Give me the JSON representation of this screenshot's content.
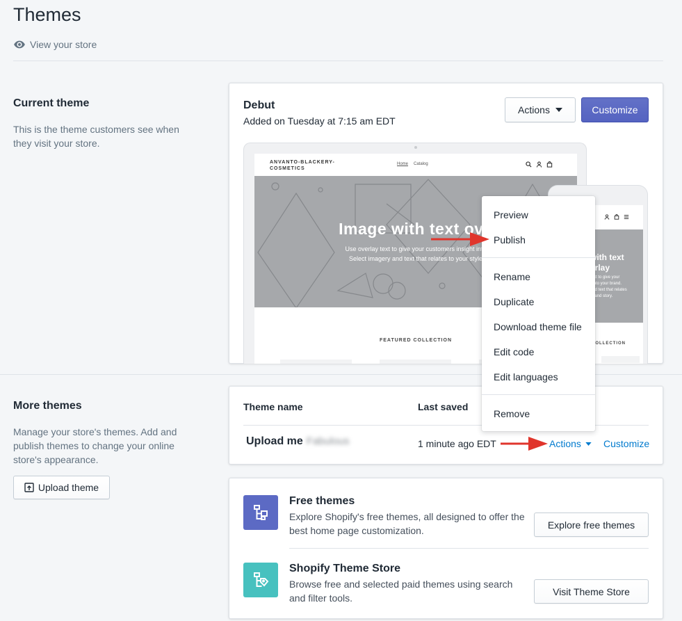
{
  "page": {
    "title": "Themes",
    "view_store": "View your store"
  },
  "current": {
    "section_title": "Current theme",
    "section_desc": "This is the theme customers see when they visit your store.",
    "theme_name": "Debut",
    "added": "Added on Tuesday at 7:15 am EDT",
    "actions_label": "Actions",
    "customize_label": "Customize"
  },
  "preview": {
    "brand_line1": "ANVANTO-BLACKERY-",
    "brand_line2": "COSMETICS",
    "nav": [
      "Home",
      "Catalog"
    ],
    "hero_title": "Image with text ove",
    "hero_sub1": "Use overlay text to give your customers insight into",
    "hero_sub2": "Select imagery and text that relates to your style",
    "featured": "FEATURED COLLECTION",
    "phone_hero_1": "with text",
    "phone_hero_2": "erlay",
    "phone_hero_sub": "text to give your\nt into your brand.\nand text that relates\nle and story.",
    "phone_featured": "COLLECTION"
  },
  "menu": {
    "items": [
      "Preview",
      "Publish",
      "Rename",
      "Duplicate",
      "Download theme file",
      "Edit code",
      "Edit languages",
      "Remove"
    ]
  },
  "more": {
    "section_title": "More themes",
    "section_desc": "Manage your store's themes. Add and publish themes to change your online store's appearance.",
    "upload_label": "Upload theme",
    "col_name": "Theme name",
    "col_saved": "Last saved",
    "row": {
      "name": "Upload me",
      "name_blurred": "Fabulous",
      "saved": "1 minute ago EDT",
      "actions": "Actions",
      "customize": "Customize"
    }
  },
  "promos": [
    {
      "title": "Free themes",
      "desc": "Explore Shopify's free themes, all designed to offer the best home page customization.",
      "button": "Explore free themes",
      "color": "#5c6ac4"
    },
    {
      "title": "Shopify Theme Store",
      "desc": "Browse free and selected paid themes using search and filter tools.",
      "button": "Visit Theme Store",
      "color": "#47c1bf"
    }
  ],
  "colors": {
    "arrow": "#e0352c",
    "link": "#007ace",
    "primary": "#5c6ac4"
  }
}
